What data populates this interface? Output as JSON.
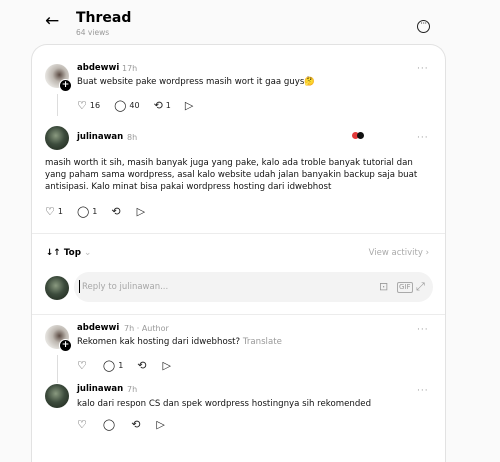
{
  "header": {
    "title": "Thread",
    "views": "64 views"
  },
  "original_post": {
    "username": "abdewwi",
    "time": "17h",
    "text": "Buat website pake wordpress masih wort it gaa guys🤔",
    "likes": "16",
    "replies": "40",
    "reposts": "1"
  },
  "first_reply": {
    "username": "julinawan",
    "time": "8h",
    "text_lines": [
      "masih worth it sih, masih banyak juga yang pake, kalo ada troble banyak tutorial dan",
      "yang paham sama wordpress, asal kalo website udah jalan banyakin backup saja buat",
      "antisipasi. Kalo minat bisa pakai wordpress hosting dari idwebhost"
    ],
    "likes": "1",
    "replies": "1"
  },
  "sort_bar": {
    "sort_label": "Top",
    "view_activity": "View activity"
  },
  "reply_box": {
    "placeholder": "Reply to julinawan..."
  },
  "comments": [
    {
      "username": "abdewwi",
      "time": "7h",
      "author_tag": "Author",
      "text": "Rekomen kak hosting dari idwebhost?",
      "translate": "Translate",
      "replies": "1"
    },
    {
      "username": "julinawan",
      "time": "7h",
      "text": "kalo dari respon CS dan spek wordpress hostingnya sih rekomended"
    }
  ],
  "colors": {
    "background": "#fafafa",
    "card": "#ffffff",
    "muted": "#999999",
    "divider": "#ececec"
  },
  "icons": [
    "back-arrow-icon",
    "more-circle-icon",
    "heart-icon",
    "comment-icon",
    "repost-icon",
    "share-icon",
    "more-dots-icon",
    "sort-icon",
    "chevron-down-icon",
    "chevron-right-icon",
    "image-icon",
    "gif-icon",
    "expand-icon"
  ]
}
